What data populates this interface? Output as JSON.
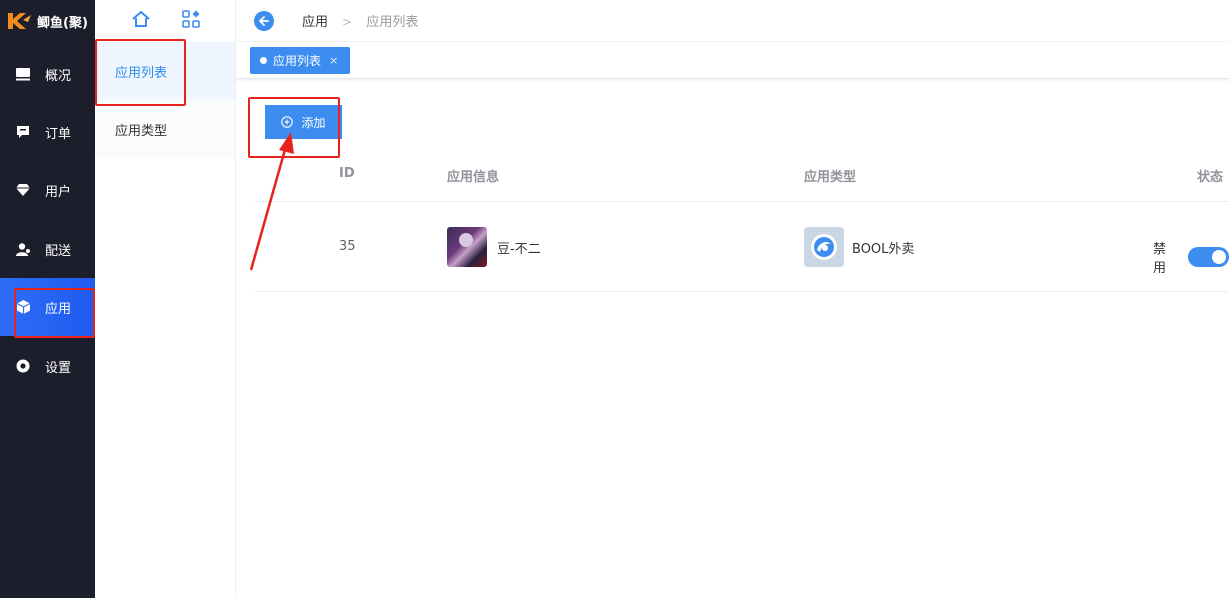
{
  "brand": {
    "name": "鲫鱼(聚)"
  },
  "sidebar": {
    "items": [
      {
        "label": "概况",
        "icon": "monitor-icon"
      },
      {
        "label": "订单",
        "icon": "order-icon"
      },
      {
        "label": "用户",
        "icon": "diamond-icon"
      },
      {
        "label": "配送",
        "icon": "user-icon"
      },
      {
        "label": "应用",
        "icon": "cube-icon",
        "active": true
      },
      {
        "label": "设置",
        "icon": "settings-icon"
      }
    ]
  },
  "submenu": {
    "items": [
      {
        "label": "应用列表",
        "active": true
      },
      {
        "label": "应用类型"
      }
    ]
  },
  "breadcrumb": {
    "root": "应用",
    "current": "应用列表"
  },
  "tabs": [
    {
      "label": "应用列表",
      "close": "×"
    }
  ],
  "toolbar": {
    "add_label": "添加"
  },
  "table": {
    "headers": {
      "id": "ID",
      "info": "应用信息",
      "type": "应用类型",
      "status": "状态"
    },
    "rows": [
      {
        "id": "35",
        "name": "豆-不二",
        "type": "BOOL外卖",
        "status": "禁用",
        "enabled": true
      }
    ]
  },
  "colors": {
    "primary": "#3d8cf0",
    "sidebar_bg": "#1d1e2c",
    "annotation": "#e8231d"
  }
}
